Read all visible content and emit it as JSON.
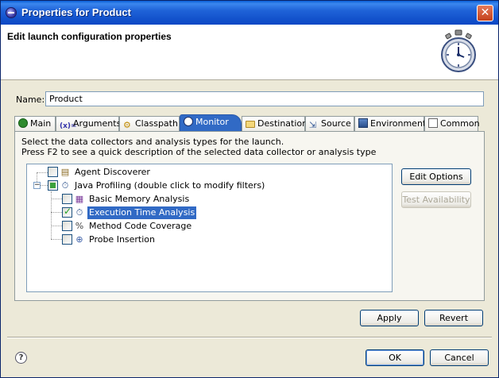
{
  "window": {
    "title": "Properties for Product",
    "close_label": "✕"
  },
  "header": {
    "title": "Edit launch configuration properties"
  },
  "name_field": {
    "label": "Name:",
    "value": "Product"
  },
  "tabs": [
    {
      "label": "Main",
      "icon": "main-icon"
    },
    {
      "label": "Arguments",
      "icon": "arguments-icon"
    },
    {
      "label": "Classpath",
      "icon": "classpath-icon"
    },
    {
      "label": "Monitor",
      "icon": "monitor-icon",
      "active": true
    },
    {
      "label": "Destination",
      "icon": "folder-icon"
    },
    {
      "label": "Source",
      "icon": "source-icon"
    },
    {
      "label": "Environment",
      "icon": "environment-icon"
    },
    {
      "label": "Common",
      "icon": "common-icon"
    }
  ],
  "monitor": {
    "description_line1": "Select the data collectors and analysis types for the launch.",
    "description_line2": "Press F2 to see a quick description of the selected data collector or analysis type",
    "tree": [
      {
        "label": "Agent Discoverer",
        "checked": false,
        "level": 0
      },
      {
        "label": "Java Profiling (double click to modify filters)",
        "checked": "partial",
        "level": 0,
        "expanded": true
      },
      {
        "label": "Basic Memory Analysis",
        "checked": false,
        "level": 1
      },
      {
        "label": "Execution Time Analysis",
        "checked": true,
        "level": 1,
        "selected": true
      },
      {
        "label": "Method Code Coverage",
        "checked": false,
        "level": 1
      },
      {
        "label": "Probe Insertion",
        "checked": false,
        "level": 1
      }
    ],
    "edit_options_label": "Edit Options",
    "test_availability_label": "Test Availability"
  },
  "buttons": {
    "apply": "Apply",
    "revert": "Revert",
    "ok": "OK",
    "cancel": "Cancel",
    "help": "?"
  },
  "colors": {
    "title_bar": "#0b47c4",
    "selection": "#316ac5",
    "dialog_bg": "#ece9d8"
  }
}
